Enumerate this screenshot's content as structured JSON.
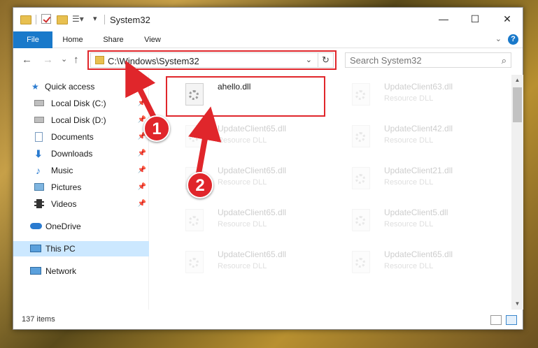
{
  "window": {
    "title": "System32",
    "minimize_glyph": "—",
    "maximize_glyph": "☐",
    "close_glyph": "✕"
  },
  "ribbon": {
    "tabs": [
      "File",
      "Home",
      "Share",
      "View"
    ],
    "collapse_glyph": "⌄",
    "help_glyph": "?"
  },
  "nav": {
    "back_glyph": "←",
    "forward_glyph": "→",
    "recent_glyph": "⌄",
    "up_glyph": "↑",
    "address": "C:\\Windows\\System32",
    "address_chevron": "⌄",
    "refresh_glyph": "↻",
    "search_placeholder": "Search System32",
    "search_glyph": "⌕"
  },
  "sidebar": {
    "items": [
      {
        "label": "Quick access",
        "icon": "star-icon",
        "pinned": false
      },
      {
        "label": "Local Disk (C:)",
        "icon": "drive-icon",
        "pinned": true
      },
      {
        "label": "Local Disk (D:)",
        "icon": "drive-icon",
        "pinned": true
      },
      {
        "label": "Documents",
        "icon": "documents-icon",
        "pinned": true
      },
      {
        "label": "Downloads",
        "icon": "download-icon",
        "pinned": true
      },
      {
        "label": "Music",
        "icon": "music-icon",
        "pinned": true
      },
      {
        "label": "Pictures",
        "icon": "pictures-icon",
        "pinned": true
      },
      {
        "label": "Videos",
        "icon": "videos-icon",
        "pinned": true
      },
      {
        "label": "OneDrive",
        "icon": "cloud-icon",
        "pinned": false
      },
      {
        "label": "This PC",
        "icon": "computer-icon",
        "pinned": false,
        "selected": true
      },
      {
        "label": "Network",
        "icon": "network-icon",
        "pinned": false
      }
    ],
    "pin_glyph": "📌"
  },
  "files": [
    {
      "name": "ahello.dll",
      "type": "",
      "faded": false
    },
    {
      "name": "UpdateClient63.dll",
      "type": "Resource DLL",
      "faded": true
    },
    {
      "name": "UpdateClient65.dll",
      "type": "Resource DLL",
      "faded": true
    },
    {
      "name": "UpdateClient42.dll",
      "type": "Resource DLL",
      "faded": true
    },
    {
      "name": "UpdateClient65.dll",
      "type": "Resource DLL",
      "faded": true
    },
    {
      "name": "UpdateClient21.dll",
      "type": "Resource DLL",
      "faded": true
    },
    {
      "name": "UpdateClient65.dll",
      "type": "Resource DLL",
      "faded": true
    },
    {
      "name": "UpdateClient5.dll",
      "type": "Resource DLL",
      "faded": true
    },
    {
      "name": "UpdateClient65.dll",
      "type": "Resource DLL",
      "faded": true
    },
    {
      "name": "UpdateClient65.dll",
      "type": "Resource DLL",
      "faded": true
    }
  ],
  "status": {
    "item_count": "137 items"
  },
  "annotations": {
    "step1": "1",
    "step2": "2",
    "color": "#e0262b"
  },
  "scroll": {
    "up_glyph": "▲",
    "down_glyph": "▼"
  }
}
